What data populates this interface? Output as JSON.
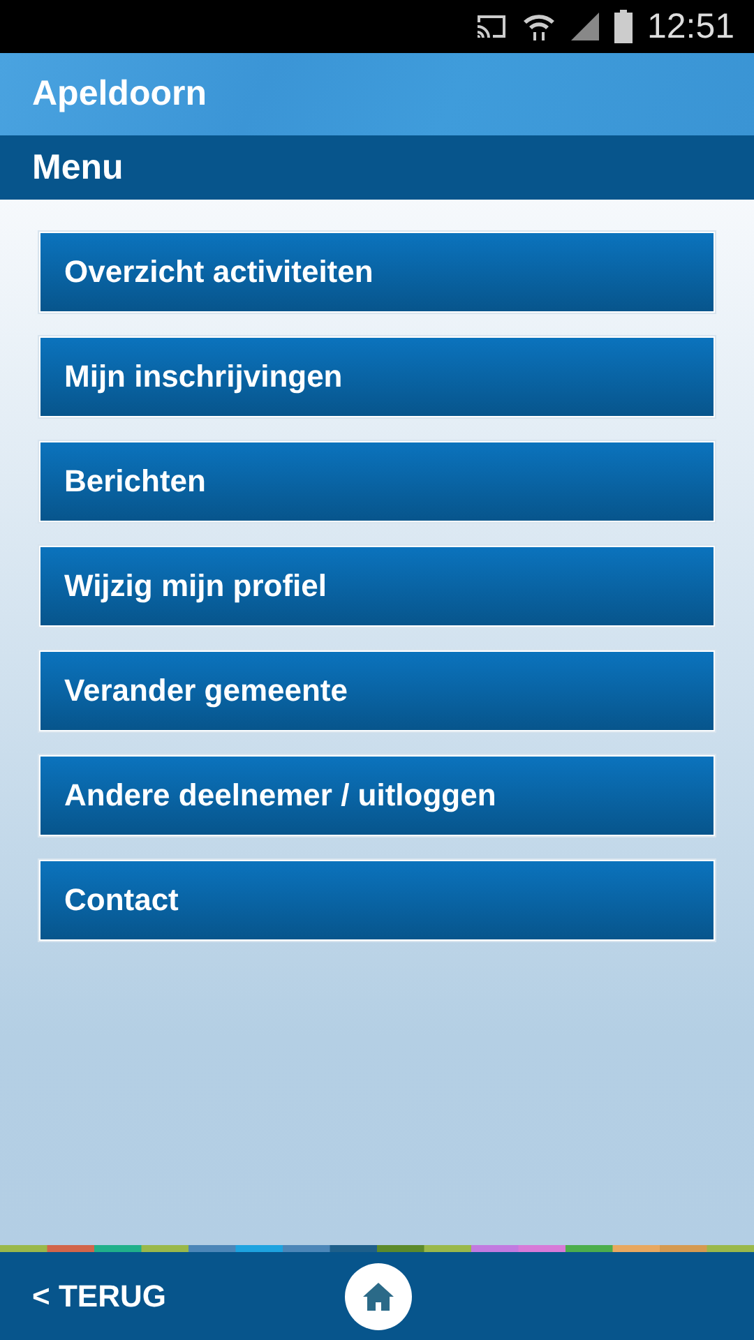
{
  "status_bar": {
    "time": "12:51"
  },
  "header": {
    "title": "Apeldoorn"
  },
  "section": {
    "title": "Menu"
  },
  "menu_items": [
    {
      "label": "Overzicht activiteiten"
    },
    {
      "label": "Mijn inschrijvingen"
    },
    {
      "label": "Berichten"
    },
    {
      "label": "Wijzig mijn profiel"
    },
    {
      "label": "Verander gemeente"
    },
    {
      "label": "Andere deelnemer / uitloggen"
    },
    {
      "label": "Contact"
    }
  ],
  "footer": {
    "back_label": "< TERUG"
  }
}
